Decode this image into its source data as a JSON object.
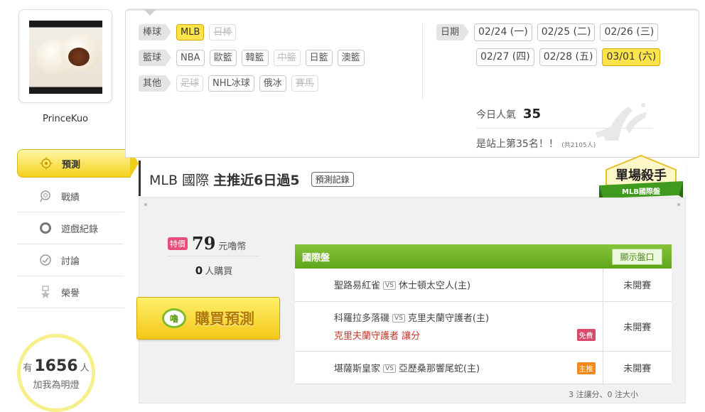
{
  "user": {
    "name": "PrinceKuo"
  },
  "menu": {
    "items": [
      {
        "label": "預測",
        "icon": "target-icon"
      },
      {
        "label": "戰績",
        "icon": "trophy-icon"
      },
      {
        "label": "遊戲紀錄",
        "icon": "ring-icon"
      },
      {
        "label": "討論",
        "icon": "chat-icon"
      },
      {
        "label": "榮譽",
        "icon": "medal-icon"
      }
    ]
  },
  "fans": {
    "prefix": "有",
    "count": "1656",
    "suffix": "人",
    "line2": "加我為明燈"
  },
  "filters": {
    "baseball": {
      "label": "棒球",
      "items": [
        "MLB",
        "日棒"
      ]
    },
    "basketball": {
      "label": "籃球",
      "items": [
        "NBA",
        "歐籃",
        "韓籃",
        "中籃",
        "日籃",
        "澳籃"
      ]
    },
    "other": {
      "label": "其他",
      "items": [
        "足球",
        "NHL冰球",
        "俄冰",
        "賽馬"
      ]
    },
    "date": {
      "label": "日期",
      "items": [
        "02/24 (一)",
        "02/25 (二)",
        "02/26 (三)",
        "02/27 (四)",
        "02/28 (五)",
        "03/01 (六)"
      ]
    }
  },
  "stats": {
    "popularity_label": "今日人氣",
    "popularity": "35",
    "rank_text": "是站上第35名！！",
    "rank_total": "(共2105人)"
  },
  "main": {
    "title_prefix": "MLB 國際",
    "title_bold": "主推近6日過5",
    "record_button": "預測記錄",
    "badge_line1": "單場殺手",
    "badge_line2": "MLB國際盤"
  },
  "purchase": {
    "special_tag": "特價",
    "price": "79",
    "price_unit": "元嚕幣",
    "buyers_count": "0",
    "buyers_unit": "人購買",
    "buy_icon": "嚕",
    "buy_label": "購買預測"
  },
  "games": {
    "title": "國際盤",
    "show_odds": "顯示盤口",
    "rows": [
      {
        "away": "聖路易紅雀",
        "vs": "VS",
        "home": "休士頓太空人(主)",
        "pick": "",
        "tag": "",
        "status": "未開賽"
      },
      {
        "away": "科羅拉多落磯",
        "vs": "VS",
        "home": "克里夫蘭守護者(主)",
        "pick": "克里夫蘭守護者  讓分",
        "tag": "免費",
        "status": "未開賽"
      },
      {
        "away": "堪薩斯皇家",
        "vs": "VS",
        "home": "亞歷桑那響尾蛇(主)",
        "pick": "",
        "tag": "主推",
        "status": "未開賽"
      }
    ],
    "summary": "3 注讓分、0 注大小"
  },
  "colors": {
    "accent_yellow": "#ffe34a",
    "table_green": "#6cb025",
    "pick_red": "#c0392b"
  }
}
